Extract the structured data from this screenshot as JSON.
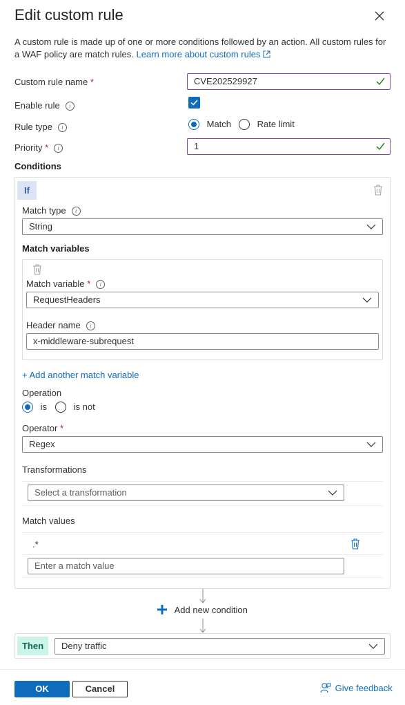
{
  "panel": {
    "title": "Edit custom rule",
    "description": "A custom rule is made up of one or more conditions followed by an action. All custom rules for a WAF policy are match rules.",
    "learn_more": "Learn more about custom rules"
  },
  "form": {
    "rule_name_label": "Custom rule name",
    "rule_name_value": "CVE202529927",
    "enable_label": "Enable rule",
    "enable_checked": true,
    "rule_type_label": "Rule type",
    "rule_type_options": [
      "Match",
      "Rate limit"
    ],
    "rule_type_selected": "Match",
    "priority_label": "Priority",
    "priority_value": "1",
    "required_mark": "*"
  },
  "conditions": {
    "heading": "Conditions",
    "if_label": "If",
    "match_type_label": "Match type",
    "match_type_value": "String",
    "match_variables_heading": "Match variables",
    "match_variable_label": "Match variable",
    "match_variable_value": "RequestHeaders",
    "header_name_label": "Header name",
    "header_name_value": "x-middleware-subrequest",
    "add_match_variable": "+ Add another match variable",
    "operation_label": "Operation",
    "operation_options": [
      "is",
      "is not"
    ],
    "operation_selected": "is",
    "operator_label": "Operator",
    "operator_value": "Regex",
    "transformations_label": "Transformations",
    "transformation_placeholder": "Select a transformation",
    "match_values_label": "Match values",
    "match_values": [
      ".*"
    ],
    "match_value_placeholder": "Enter a match value",
    "add_condition": "Add new condition"
  },
  "action": {
    "then_label": "Then",
    "value": "Deny traffic"
  },
  "footer": {
    "ok_label": "OK",
    "cancel_label": "Cancel",
    "feedback_label": "Give feedback"
  },
  "colors": {
    "accent": "#0f6cbd",
    "valid_border": "#8a3fb4",
    "valid_check": "#107c10",
    "required": "#a4262c"
  }
}
